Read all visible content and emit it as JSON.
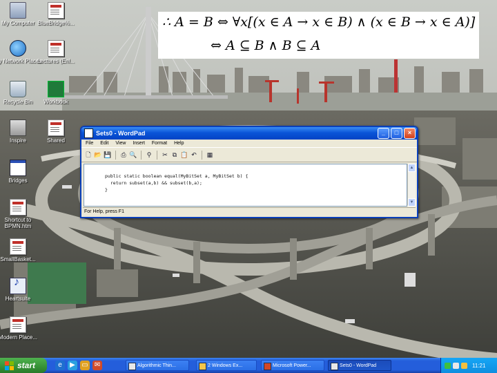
{
  "desktop_icons": [
    {
      "label": "My Computer",
      "icon": "my-computer-icon"
    },
    {
      "label": "BlueBridge%...",
      "icon": "document-icon"
    },
    {
      "label": "My Network Places",
      "icon": "network-places-icon"
    },
    {
      "label": "Lectures (Enl...",
      "icon": "document-icon"
    },
    {
      "label": "Recycle Bin",
      "icon": "recycle-bin-icon"
    },
    {
      "label": "Workbook",
      "icon": "excel-icon"
    },
    {
      "label": "Inspire",
      "icon": "shortcut-icon"
    },
    {
      "label": "Shared",
      "icon": "document-icon"
    },
    {
      "label": "Bridges",
      "icon": "window-icon"
    },
    {
      "label": "Shortcut to BPMN.htm",
      "icon": "document-icon"
    },
    {
      "label": "SmallBasket...",
      "icon": "document-icon"
    },
    {
      "label": "Heartsuite",
      "icon": "music-icon"
    },
    {
      "label": "Modern Place...",
      "icon": "document-icon"
    }
  ],
  "formula": {
    "line1": "∴ A = B ⇔ ∀x[(x ∈ A → x ∈ B) ∧ (x ∈ B → x ∈ A)]",
    "line2": "⇔ A ⊆ B ∧ B ⊆ A"
  },
  "wordpad": {
    "title": "Sets0 - WordPad",
    "menu": [
      "File",
      "Edit",
      "View",
      "Insert",
      "Format",
      "Help"
    ],
    "code_line1": "public static boolean equal(MyBitSet a, MyBitSet b) {",
    "code_line2": "  return subset(a,b) && subset(b,a);",
    "code_line3": "}",
    "status": "For Help, press F1",
    "buttons": {
      "minimize": "_",
      "maximize": "□",
      "close": "×"
    }
  },
  "taskbar": {
    "start_label": "start",
    "tasks": [
      {
        "label": "Algorithmic Thin..."
      },
      {
        "label": "2 Windows Ex..."
      },
      {
        "label": "Microsoft Power..."
      },
      {
        "label": "Sets0 - WordPad"
      }
    ],
    "clock": "11:21"
  },
  "colors": {
    "taskbar_blue": "#245edb",
    "start_green": "#369136",
    "title_blue": "#0a55d8",
    "tray_blue": "#0f8ee0"
  }
}
